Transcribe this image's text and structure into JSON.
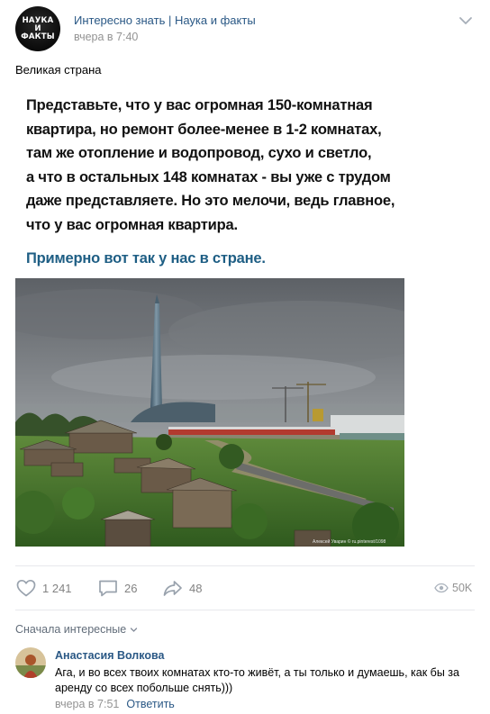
{
  "header": {
    "avatar_logo_lines": [
      "НАУКА",
      "И",
      "ФАКТЫ"
    ],
    "group_name": "Интересно знать | Наука и факты",
    "post_time": "вчера в 7:40",
    "menu_icon": "chevron-down-icon"
  },
  "post": {
    "text": "Великая страна",
    "meme_body": "Представьте, что у вас огромная 150-комнатная\nквартира, но ремонт более-менее в 1-2 комнатах,\nтам же отопление и водопровод, сухо и светло,\nа что в остальных 148 комнатах - вы уже с трудом\nдаже представляете. Но это мелочи, ведь главное,\nчто у вас огромная квартира.",
    "meme_caption": "Примерно вот так у нас в стране.",
    "photo_watermark": "Алексей Уварин © ru.pinterest/1098",
    "photo_alt": "skyscraper-over-old-village-photo"
  },
  "actions": {
    "likes": "1 241",
    "comments": "26",
    "shares": "48",
    "views": "50K",
    "like_icon": "heart-icon",
    "comment_icon": "comment-icon",
    "share_icon": "share-arrow-icon",
    "views_icon": "eye-icon"
  },
  "comments": {
    "sort_label": "Сначала интересные",
    "items": [
      {
        "author": "Анастасия Волкова",
        "text": "Ага, и во всех твоих комнатах кто-то живёт, а ты только и думаешь, как бы за аренду со всех побольше снять)))",
        "time": "вчера в 7:51",
        "reply_label": "Ответить"
      }
    ]
  },
  "colors": {
    "link": "#2a5885",
    "secondary": "#939393",
    "meme_caption": "#1e5e84",
    "divider": "#e7e8ec"
  }
}
